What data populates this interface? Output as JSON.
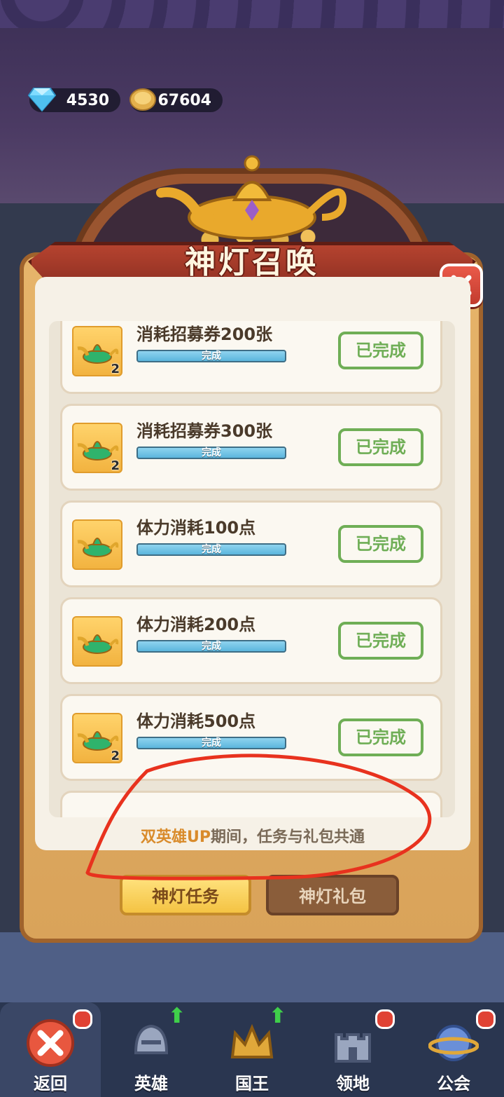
{
  "currency": {
    "gems": "4530",
    "coins": "67604"
  },
  "title": "神灯召唤",
  "tasks": [
    {
      "name": "消耗招募券200张",
      "progress_text": "完成",
      "progress": 1.0,
      "reward_qty": "2",
      "button": "已完成"
    },
    {
      "name": "消耗招募券300张",
      "progress_text": "完成",
      "progress": 1.0,
      "reward_qty": "2",
      "button": "已完成"
    },
    {
      "name": "体力消耗100点",
      "progress_text": "完成",
      "progress": 1.0,
      "reward_qty": "",
      "button": "已完成"
    },
    {
      "name": "体力消耗200点",
      "progress_text": "完成",
      "progress": 1.0,
      "reward_qty": "",
      "button": "已完成"
    },
    {
      "name": "体力消耗500点",
      "progress_text": "完成",
      "progress": 1.0,
      "reward_qty": "2",
      "button": "已完成"
    }
  ],
  "notice": {
    "highlight": "双英雄UP",
    "rest": "期间，任务与礼包共通"
  },
  "tabs": {
    "tasks": "神灯任务",
    "gift": "神灯礼包"
  },
  "nav": [
    {
      "label": "返回",
      "icon": "close-icon"
    },
    {
      "label": "英雄",
      "icon": "helmet-icon"
    },
    {
      "label": "国王",
      "icon": "crown-icon"
    },
    {
      "label": "领地",
      "icon": "castle-icon"
    },
    {
      "label": "公会",
      "icon": "planet-icon"
    }
  ],
  "colors": {
    "done_green": "#6fae56",
    "bar_blue": "#5bb6dd",
    "annotation_red": "#e8321e"
  }
}
